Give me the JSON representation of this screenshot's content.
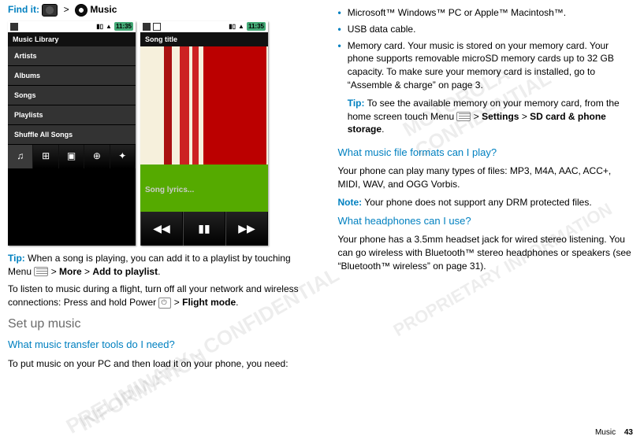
{
  "findit": {
    "label": "Find it:",
    "gt": ">",
    "music": "Music"
  },
  "phone1": {
    "clock": "11:35",
    "header": "Music Library",
    "items": [
      "Artists",
      "Albums",
      "Songs",
      "Playlists",
      "Shuffle All Songs"
    ],
    "nav": [
      "♫",
      "⊞",
      "▣",
      "⊕",
      "✦"
    ]
  },
  "phone2": {
    "clock": "11:35",
    "header": "Song title",
    "lyrics": "Song lyrics...",
    "controls": [
      "◀◀",
      "▮▮",
      "▶▶"
    ]
  },
  "left": {
    "tip1_label": "Tip:",
    "tip1_text": " When a song is playing, you can add it to a playlist by touching Menu ",
    "tip1_more": "More",
    "tip1_add": "Add to playlist",
    "flight1": "To listen to music during a flight, turn off all your network and wireless connections: Press and hold Power ",
    "flight_mode": "Flight mode",
    "gt": " > ",
    "section": "Set up music",
    "subsection": "What music transfer tools do I need?",
    "p1": "To put music on your PC and then load it on your phone, you need:"
  },
  "right": {
    "bullets": [
      "Microsoft™ Windows™ PC or Apple™ Macintosh™.",
      "USB data cable.",
      "Memory card. Your music is stored on your memory card. Your phone supports removable microSD memory cards up to 32 GB capacity. To make sure your memory card is installed, go to “Assemble & charge” on page 3."
    ],
    "tip_label": "Tip:",
    "tip_text": " To see the available memory on your memory card, from the home screen touch Menu ",
    "gt": " > ",
    "settings": "Settings",
    "sd": "SD card & phone storage",
    "period": ".",
    "sub_formats": "What music file formats can I play?",
    "formats_text": "Your phone can play many types of files: MP3, M4A, AAC, ACC+, MIDI, WAV, and OGG Vorbis.",
    "note_label": "Note:",
    "note_text": " Your phone does not support any DRM protected files.",
    "sub_hp": "What headphones can I use?",
    "hp_text": "Your phone has a 3.5mm headset jack for wired stereo listening. You can go wireless with Bluetooth™ stereo headphones or speakers (see “Bluetooth™ wireless” on page 31)."
  },
  "footer": {
    "section": "Music",
    "page": "43"
  },
  "watermarks": [
    "INFORMATION",
    "PRELIMINARY - CONFIDENTIAL",
    "MOTOROLA CONFIDENTIAL",
    "PROPRIETARY INFORMATION"
  ]
}
